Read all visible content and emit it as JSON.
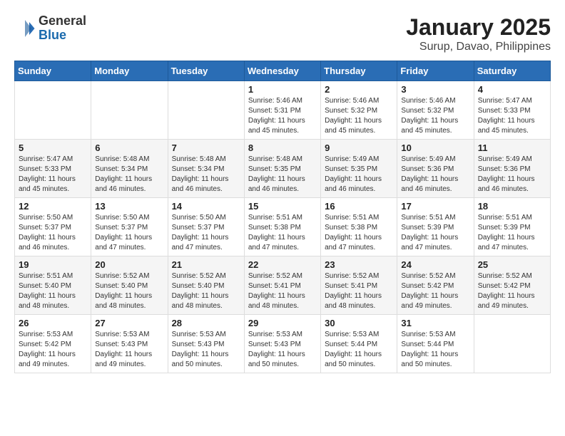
{
  "header": {
    "logo_general": "General",
    "logo_blue": "Blue",
    "main_title": "January 2025",
    "subtitle": "Surup, Davao, Philippines"
  },
  "calendar": {
    "days_of_week": [
      "Sunday",
      "Monday",
      "Tuesday",
      "Wednesday",
      "Thursday",
      "Friday",
      "Saturday"
    ],
    "weeks": [
      [
        {
          "day": "",
          "info": ""
        },
        {
          "day": "",
          "info": ""
        },
        {
          "day": "",
          "info": ""
        },
        {
          "day": "1",
          "info": "Sunrise: 5:46 AM\nSunset: 5:31 PM\nDaylight: 11 hours and 45 minutes."
        },
        {
          "day": "2",
          "info": "Sunrise: 5:46 AM\nSunset: 5:32 PM\nDaylight: 11 hours and 45 minutes."
        },
        {
          "day": "3",
          "info": "Sunrise: 5:46 AM\nSunset: 5:32 PM\nDaylight: 11 hours and 45 minutes."
        },
        {
          "day": "4",
          "info": "Sunrise: 5:47 AM\nSunset: 5:33 PM\nDaylight: 11 hours and 45 minutes."
        }
      ],
      [
        {
          "day": "5",
          "info": "Sunrise: 5:47 AM\nSunset: 5:33 PM\nDaylight: 11 hours and 45 minutes."
        },
        {
          "day": "6",
          "info": "Sunrise: 5:48 AM\nSunset: 5:34 PM\nDaylight: 11 hours and 46 minutes."
        },
        {
          "day": "7",
          "info": "Sunrise: 5:48 AM\nSunset: 5:34 PM\nDaylight: 11 hours and 46 minutes."
        },
        {
          "day": "8",
          "info": "Sunrise: 5:48 AM\nSunset: 5:35 PM\nDaylight: 11 hours and 46 minutes."
        },
        {
          "day": "9",
          "info": "Sunrise: 5:49 AM\nSunset: 5:35 PM\nDaylight: 11 hours and 46 minutes."
        },
        {
          "day": "10",
          "info": "Sunrise: 5:49 AM\nSunset: 5:36 PM\nDaylight: 11 hours and 46 minutes."
        },
        {
          "day": "11",
          "info": "Sunrise: 5:49 AM\nSunset: 5:36 PM\nDaylight: 11 hours and 46 minutes."
        }
      ],
      [
        {
          "day": "12",
          "info": "Sunrise: 5:50 AM\nSunset: 5:37 PM\nDaylight: 11 hours and 46 minutes."
        },
        {
          "day": "13",
          "info": "Sunrise: 5:50 AM\nSunset: 5:37 PM\nDaylight: 11 hours and 47 minutes."
        },
        {
          "day": "14",
          "info": "Sunrise: 5:50 AM\nSunset: 5:37 PM\nDaylight: 11 hours and 47 minutes."
        },
        {
          "day": "15",
          "info": "Sunrise: 5:51 AM\nSunset: 5:38 PM\nDaylight: 11 hours and 47 minutes."
        },
        {
          "day": "16",
          "info": "Sunrise: 5:51 AM\nSunset: 5:38 PM\nDaylight: 11 hours and 47 minutes."
        },
        {
          "day": "17",
          "info": "Sunrise: 5:51 AM\nSunset: 5:39 PM\nDaylight: 11 hours and 47 minutes."
        },
        {
          "day": "18",
          "info": "Sunrise: 5:51 AM\nSunset: 5:39 PM\nDaylight: 11 hours and 47 minutes."
        }
      ],
      [
        {
          "day": "19",
          "info": "Sunrise: 5:51 AM\nSunset: 5:40 PM\nDaylight: 11 hours and 48 minutes."
        },
        {
          "day": "20",
          "info": "Sunrise: 5:52 AM\nSunset: 5:40 PM\nDaylight: 11 hours and 48 minutes."
        },
        {
          "day": "21",
          "info": "Sunrise: 5:52 AM\nSunset: 5:40 PM\nDaylight: 11 hours and 48 minutes."
        },
        {
          "day": "22",
          "info": "Sunrise: 5:52 AM\nSunset: 5:41 PM\nDaylight: 11 hours and 48 minutes."
        },
        {
          "day": "23",
          "info": "Sunrise: 5:52 AM\nSunset: 5:41 PM\nDaylight: 11 hours and 48 minutes."
        },
        {
          "day": "24",
          "info": "Sunrise: 5:52 AM\nSunset: 5:42 PM\nDaylight: 11 hours and 49 minutes."
        },
        {
          "day": "25",
          "info": "Sunrise: 5:52 AM\nSunset: 5:42 PM\nDaylight: 11 hours and 49 minutes."
        }
      ],
      [
        {
          "day": "26",
          "info": "Sunrise: 5:53 AM\nSunset: 5:42 PM\nDaylight: 11 hours and 49 minutes."
        },
        {
          "day": "27",
          "info": "Sunrise: 5:53 AM\nSunset: 5:43 PM\nDaylight: 11 hours and 49 minutes."
        },
        {
          "day": "28",
          "info": "Sunrise: 5:53 AM\nSunset: 5:43 PM\nDaylight: 11 hours and 50 minutes."
        },
        {
          "day": "29",
          "info": "Sunrise: 5:53 AM\nSunset: 5:43 PM\nDaylight: 11 hours and 50 minutes."
        },
        {
          "day": "30",
          "info": "Sunrise: 5:53 AM\nSunset: 5:44 PM\nDaylight: 11 hours and 50 minutes."
        },
        {
          "day": "31",
          "info": "Sunrise: 5:53 AM\nSunset: 5:44 PM\nDaylight: 11 hours and 50 minutes."
        },
        {
          "day": "",
          "info": ""
        }
      ]
    ]
  }
}
